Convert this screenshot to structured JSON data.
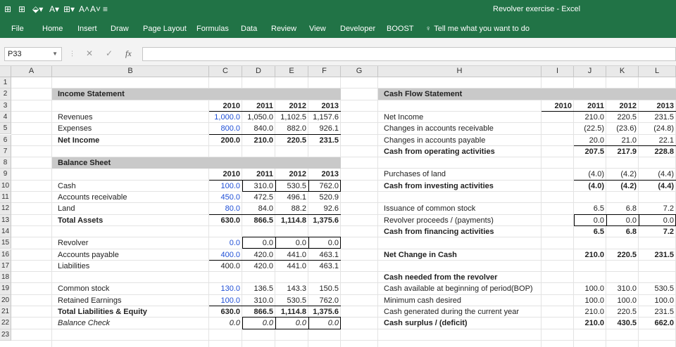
{
  "window": {
    "title": "Revolver exercise - Excel"
  },
  "quick_access": {
    "items": [
      {
        "icon": "save-icon",
        "glyph": "⊞"
      },
      {
        "icon": "grid-icon",
        "glyph": "⊞"
      },
      {
        "icon": "fill-color-icon",
        "glyph": "⬙▾"
      },
      {
        "icon": "font-color-icon",
        "glyph": "A▾"
      },
      {
        "icon": "borders-icon",
        "glyph": "⊞▾"
      },
      {
        "icon": "increase-font-icon",
        "glyph": "A˄"
      },
      {
        "icon": "decrease-font-icon",
        "glyph": "A˅"
      },
      {
        "icon": "customize-icon",
        "glyph": "≡"
      }
    ]
  },
  "ribbon": {
    "tabs": [
      "File",
      "Home",
      "Insert",
      "Draw",
      "Page Layout",
      "Formulas",
      "Data",
      "Review",
      "View",
      "Developer",
      "BOOST"
    ],
    "tell_me": "Tell me what you want to do",
    "tell_me_icon": "lightbulb-icon"
  },
  "formula_bar": {
    "name_box": "P33",
    "cancel": "✕",
    "enter": "✓",
    "fx": "fx",
    "value": ""
  },
  "columns": [
    "A",
    "B",
    "C",
    "D",
    "E",
    "F",
    "G",
    "H",
    "I",
    "J",
    "K",
    "L"
  ],
  "rows": [
    "1",
    "2",
    "3",
    "4",
    "5",
    "6",
    "7",
    "8",
    "9",
    "10",
    "11",
    "12",
    "13",
    "14",
    "15",
    "16",
    "17",
    "18",
    "19",
    "20",
    "21",
    "22",
    "23"
  ],
  "cells": {
    "B2": "Income Statement",
    "C3": "2010",
    "D3": "2011",
    "E3": "2012",
    "F3": "2013",
    "B4": "Revenues",
    "C4": "1,000.0",
    "D4": "1,050.0",
    "E4": "1,102.5",
    "F4": "1,157.6",
    "B5": "Expenses",
    "C5": "800.0",
    "D5": "840.0",
    "E5": "882.0",
    "F5": "926.1",
    "B6": "Net Income",
    "C6": "200.0",
    "D6": "210.0",
    "E6": "220.5",
    "F6": "231.5",
    "B8": "Balance Sheet",
    "C9": "2010",
    "D9": "2011",
    "E9": "2012",
    "F9": "2013",
    "B10": "Cash",
    "C10": "100.0",
    "D10": "310.0",
    "E10": "530.5",
    "F10": "762.0",
    "B11": "Accounts receivable",
    "C11": "450.0",
    "D11": "472.5",
    "E11": "496.1",
    "F11": "520.9",
    "B12": "Land",
    "C12": "80.0",
    "D12": "84.0",
    "E12": "88.2",
    "F12": "92.6",
    "B13": "Total Assets",
    "C13": "630.0",
    "D13": "866.5",
    "E13": "1,114.8",
    "F13": "1,375.6",
    "B15": "Revolver",
    "C15": "0.0",
    "D15": "0.0",
    "E15": "0.0",
    "F15": "0.0",
    "B16": "Accounts payable",
    "C16": "400.0",
    "D16": "420.0",
    "E16": "441.0",
    "F16": "463.1",
    "B17": "Liabilities",
    "C17": "400.0",
    "D17": "420.0",
    "E17": "441.0",
    "F17": "463.1",
    "B19": "Common stock",
    "C19": "130.0",
    "D19": "136.5",
    "E19": "143.3",
    "F19": "150.5",
    "B20": "Retained Earnings",
    "C20": "100.0",
    "D20": "310.0",
    "E20": "530.5",
    "F20": "762.0",
    "B21": "Total Liabilities & Equity",
    "C21": "630.0",
    "D21": "866.5",
    "E21": "1,114.8",
    "F21": "1,375.6",
    "B22": "Balance Check",
    "C22": "0.0",
    "D22": "0.0",
    "E22": "0.0",
    "F22": "0.0",
    "H2": "Cash Flow Statement",
    "I3": "2010",
    "J3": "2011",
    "K3": "2012",
    "L3": "2013",
    "H4": "Net Income",
    "J4": "210.0",
    "K4": "220.5",
    "L4": "231.5",
    "H5": "Changes in accounts receivable",
    "J5": "(22.5)",
    "K5": "(23.6)",
    "L5": "(24.8)",
    "H6": "Changes in accounts payable",
    "J6": "20.0",
    "K6": "21.0",
    "L6": "22.1",
    "H7": "Cash from operating activities",
    "J7": "207.5",
    "K7": "217.9",
    "L7": "228.8",
    "H9": "Purchases of land",
    "J9": "(4.0)",
    "K9": "(4.2)",
    "L9": "(4.4)",
    "H10": "Cash from investing activities",
    "J10": "(4.0)",
    "K10": "(4.2)",
    "L10": "(4.4)",
    "H12": "Issuance of common stock",
    "J12": "6.5",
    "K12": "6.8",
    "L12": "7.2",
    "H13": "Revolver proceeds / (payments)",
    "J13": "0.0",
    "K13": "0.0",
    "L13": "0.0",
    "H14": "Cash from financing activities",
    "J14": "6.5",
    "K14": "6.8",
    "L14": "7.2",
    "H16": "Net Change in Cash",
    "J16": "210.0",
    "K16": "220.5",
    "L16": "231.5",
    "H18": "Cash needed from the revolver",
    "H19": "Cash available at beginning of period(BOP)",
    "J19": "100.0",
    "K19": "310.0",
    "L19": "530.5",
    "H20": "Minimum cash desired",
    "J20": "100.0",
    "K20": "100.0",
    "L20": "100.0",
    "H21": "Cash generated during the current year",
    "J21": "210.0",
    "K21": "220.5",
    "L21": "231.5",
    "H22": "Cash surplus / (deficit)",
    "J22": "210.0",
    "K22": "430.5",
    "L22": "662.0"
  },
  "bold_cells": [
    "B2",
    "C3",
    "D3",
    "E3",
    "F3",
    "B6",
    "C6",
    "D6",
    "E6",
    "F6",
    "B8",
    "C9",
    "D9",
    "E9",
    "F9",
    "B13",
    "C13",
    "D13",
    "E13",
    "F13",
    "B21",
    "C21",
    "D21",
    "E21",
    "F21",
    "H2",
    "I3",
    "J3",
    "K3",
    "L3",
    "H7",
    "J7",
    "K7",
    "L7",
    "H10",
    "J10",
    "K10",
    "L10",
    "H14",
    "J14",
    "K14",
    "L14",
    "H16",
    "J16",
    "K16",
    "L16",
    "H18",
    "H22",
    "J22",
    "K22",
    "L22"
  ],
  "italic_cells": [
    "B22",
    "C22",
    "D22",
    "E22",
    "F22"
  ],
  "blue_cells": [
    "C4",
    "C5",
    "C10",
    "C11",
    "C12",
    "C15",
    "C16",
    "C19",
    "C20"
  ],
  "boxed_ranges": [
    [
      "D10",
      "F10"
    ],
    [
      "D15",
      "F15"
    ],
    [
      "D22",
      "F22"
    ],
    [
      "J13",
      "L13"
    ]
  ],
  "underlined_ranges": [
    [
      "C3",
      "F3"
    ],
    [
      "C5",
      "F5"
    ],
    [
      "C9",
      "F9"
    ],
    [
      "C12",
      "F12"
    ],
    [
      "C16",
      "F16"
    ],
    [
      "C20",
      "F20"
    ],
    [
      "I3",
      "L3"
    ],
    [
      "J6",
      "L6"
    ],
    [
      "J9",
      "L9"
    ],
    [
      "J13",
      "L13"
    ]
  ],
  "colors": {
    "excel_green": "#217346",
    "header_gray": "#c9c9c9",
    "input_blue": "#1f4fd6"
  }
}
